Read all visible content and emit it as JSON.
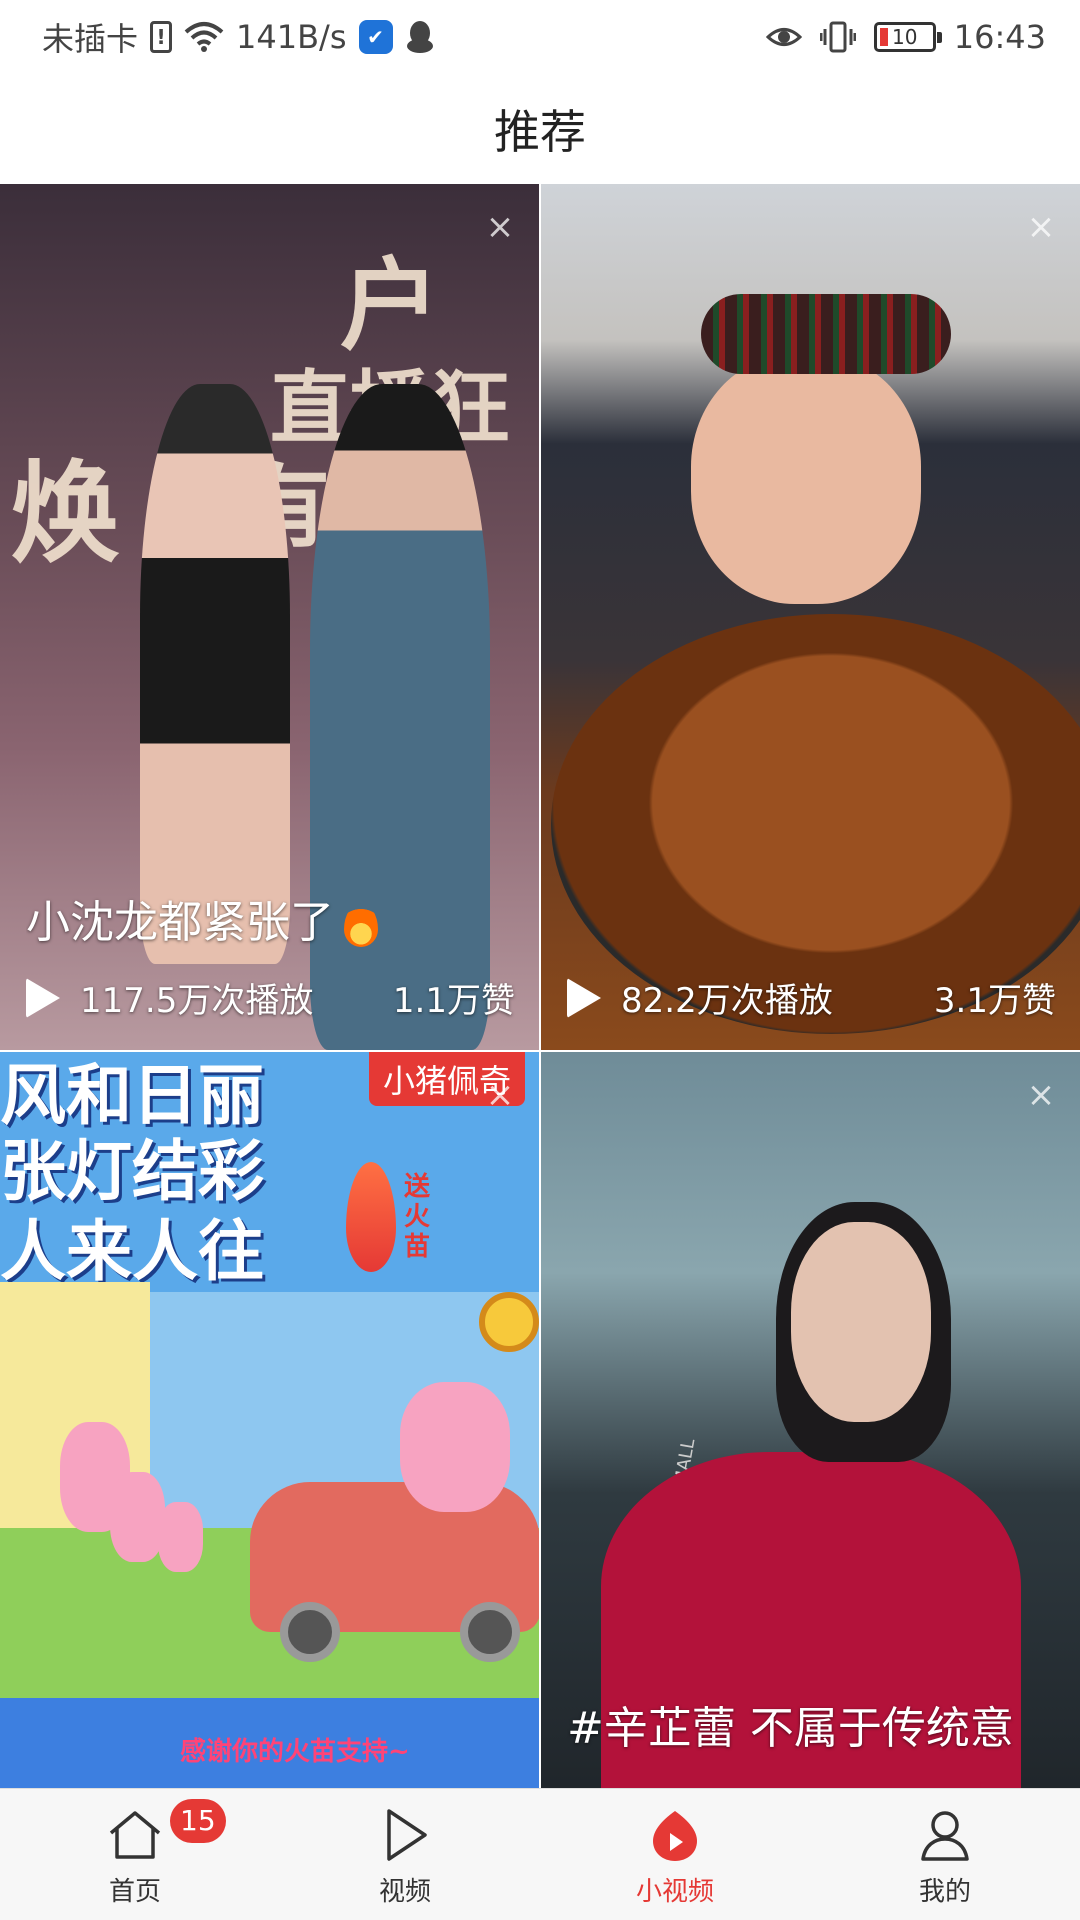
{
  "status_bar": {
    "carrier": "未插卡",
    "net_speed": "141B/s",
    "battery": "10",
    "time": "16:43",
    "icons": [
      "sim-alert-icon",
      "wifi-icon",
      "shield-icon",
      "qq-icon",
      "eye-icon",
      "vibrate-icon",
      "battery-icon"
    ]
  },
  "header": {
    "title": "推荐"
  },
  "feed": [
    {
      "caption": "小沈龙都紧张了",
      "caption_emoji": "fire-icon",
      "plays": "117.5万次播放",
      "likes": "1.1万赞",
      "thumb_text_1": "户外",
      "thumb_text_2": "直播狂",
      "thumb_text_3": "焕",
      "thumb_text_4": "有"
    },
    {
      "caption": "",
      "plays": "82.2万次播放",
      "likes": "3.1万赞"
    },
    {
      "caption": "",
      "thumb_text_1": "风和日丽",
      "thumb_text_2": "张灯结彩",
      "thumb_text_3": "人来人往",
      "thumb_tag": "小猪佩奇",
      "thumb_mark": "送火苗",
      "thumb_footer": "感谢你的火苗支持~"
    },
    {
      "caption": "#辛芷蕾 不属于传统意",
      "thumb_sign": "MALL"
    }
  ],
  "bottom_nav": {
    "items": [
      {
        "label": "首页",
        "icon": "home-icon",
        "badge": "15"
      },
      {
        "label": "视频",
        "icon": "play-icon"
      },
      {
        "label": "小视频",
        "icon": "small-video-icon",
        "active": true
      },
      {
        "label": "我的",
        "icon": "profile-icon"
      }
    ],
    "active_color": "#e53935"
  }
}
